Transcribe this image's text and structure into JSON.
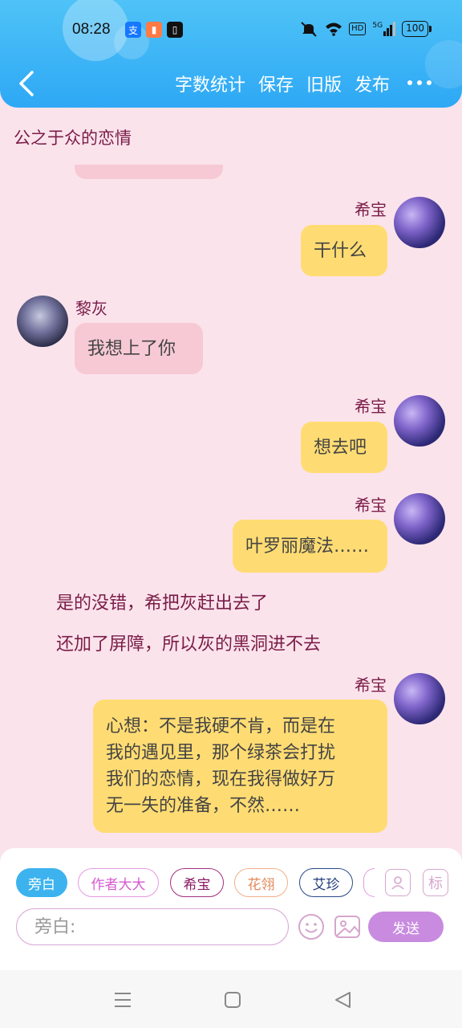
{
  "status": {
    "time": "08:28",
    "battery": "100",
    "hd_label": "HD",
    "signal_label": "5G"
  },
  "header": {
    "actions": [
      "字数统计",
      "保存",
      "旧版",
      "发布"
    ]
  },
  "story_title": "公之于众的恋情",
  "messages": [
    {
      "speaker": "希宝",
      "text": "干什么"
    },
    {
      "speaker": "黎灰",
      "text": "我想上了你"
    },
    {
      "speaker": "希宝",
      "text": "想去吧"
    },
    {
      "speaker": "希宝",
      "text": "叶罗丽魔法……"
    },
    {
      "narration": "是的没错，希把灰赶出去了"
    },
    {
      "narration": "还加了屏障，所以灰的黑洞进不去"
    },
    {
      "speaker": "希宝",
      "text_lines": [
        "心想：不是我硬不肯，而是在",
        "我的遇见里，那个绿茶会打扰",
        "我们的恋情，现在我得做好万",
        "无一失的准备，不然……"
      ]
    }
  ],
  "composer": {
    "roles": [
      "旁白",
      "作者大大",
      "希宝",
      "花翎",
      "艾珍"
    ],
    "tag_button": "标",
    "input_placeholder": "旁白:",
    "send_label": "发送"
  },
  "icons": {
    "back": "chevron-left-icon",
    "more": "more-dots-icon",
    "contact": "person-card-icon",
    "emoji": "emoji-icon",
    "image": "image-icon",
    "menu": "menu-icon",
    "home": "home-square-icon",
    "nav_back": "triangle-back-icon"
  },
  "colors": {
    "header": "#2ea8f5",
    "background": "#fbe3ec",
    "right_bubble": "#ffdc73",
    "left_bubble": "#f6c9d4",
    "accent_text": "#7a1c47",
    "send_button": "#c88bdf"
  }
}
